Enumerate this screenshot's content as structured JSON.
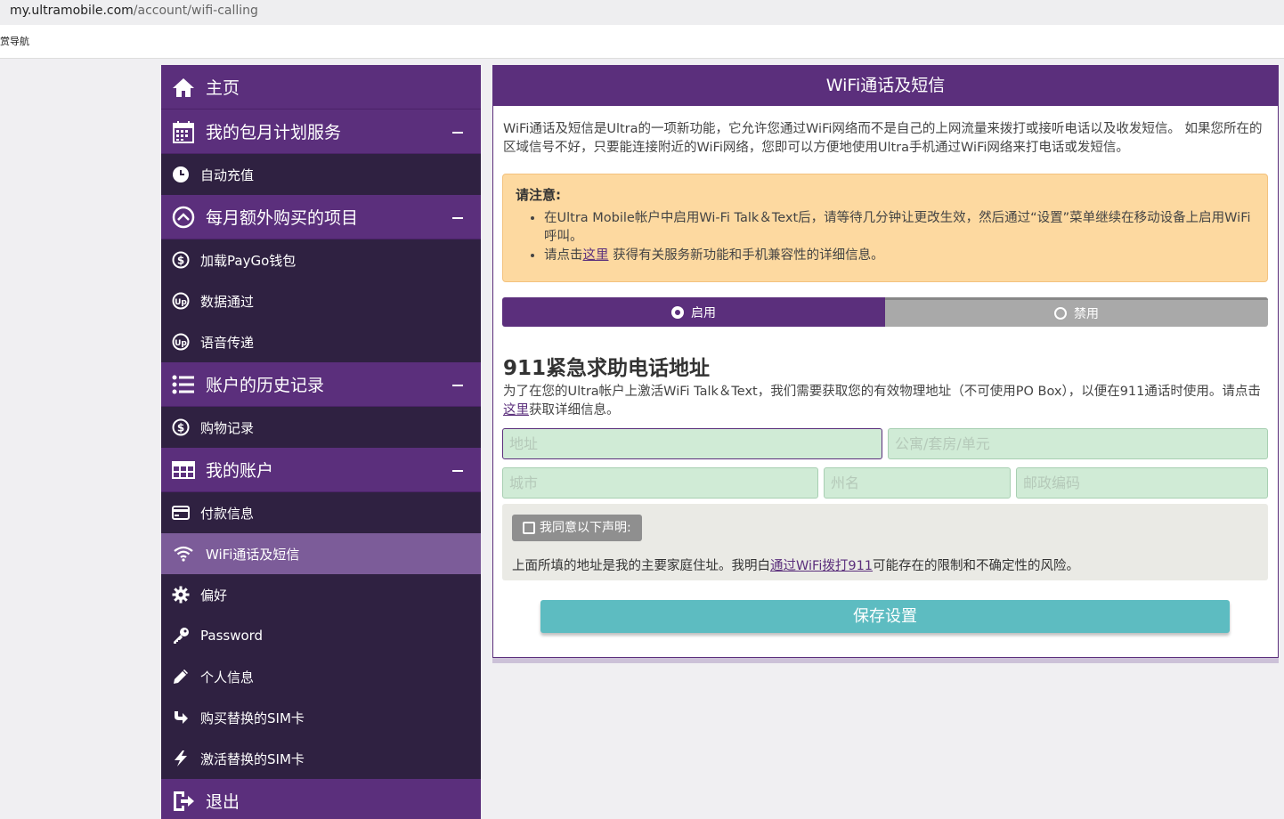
{
  "browser": {
    "url_host": "my.ultramobile.com",
    "url_path": "/account/wifi-calling",
    "bookmark": "赏导航"
  },
  "sidebar": {
    "home": "主页",
    "plan_section": "我的包月计划服务",
    "auto_recharge": "自动充值",
    "extras_section": "每月额外购买的项目",
    "paygo": "加载PayGo钱包",
    "data_pass": "数据通过",
    "voice": "语音传递",
    "history_section": "账户的历史记录",
    "purchases": "购物记录",
    "account_section": "我的账户",
    "payment": "付款信息",
    "wifi": "WiFi通话及短信",
    "prefs": "偏好",
    "password": "Password",
    "personal": "个人信息",
    "buy_sim": "购买替换的SIM卡",
    "activate_sim": "激活替换的SIM卡",
    "logout": "退出"
  },
  "panel": {
    "title": "WiFi通话及短信",
    "intro": "WiFi通话及短信是Ultra的一项新功能，它允许您通过WiFi网络而不是自己的上网流量来拨打或接听电话以及收发短信。 如果您所在的区域信号不好，只要能连接附近的WiFi网络，您即可以方便地使用Ultra手机通过WiFi网络来打电话或发短信。",
    "notice_title": "请注意:",
    "notice_1": "在Ultra Mobile帐户中启用Wi-Fi Talk＆Text后，请等待几分钟让更改生效，然后通过“设置”菜单继续在移动设备上启用WiFi呼叫。",
    "notice_2_pre": "请点击",
    "notice_2_link": "这里",
    "notice_2_post": " 获得有关服务新功能和手机兼容性的详细信息。",
    "enable": "启用",
    "disable": "禁用",
    "heading_911": "911紧急求助电话地址",
    "desc_911_a": "为了在您的Ultra帐户上激活WiFi Talk＆Text，我们需要获取您的有效物理地址（不可使用PO Box），以便在911通话时使用。请点击",
    "desc_911_link": "这里",
    "desc_911_b": "获取详细信息。",
    "address_ph": "地址",
    "apt_ph": "公寓/套房/单元",
    "city_ph": "城市",
    "state_ph": "州名",
    "zip_ph": "邮政编码",
    "agree_label": "我同意以下声明:",
    "agree_pre": "上面所填的地址是我的主要家庭住址。我明白",
    "agree_link": "通过WiFi拨打911",
    "agree_post": "可能存在的限制和不确定性的风险。",
    "save": "保存设置"
  },
  "colors": {
    "brand_purple": "#5b2f7c",
    "sidebar_dark": "#2f2141",
    "active_item": "#7c5c99",
    "save_teal": "#5dbcc1",
    "notice_bg": "#fdd9a0"
  }
}
